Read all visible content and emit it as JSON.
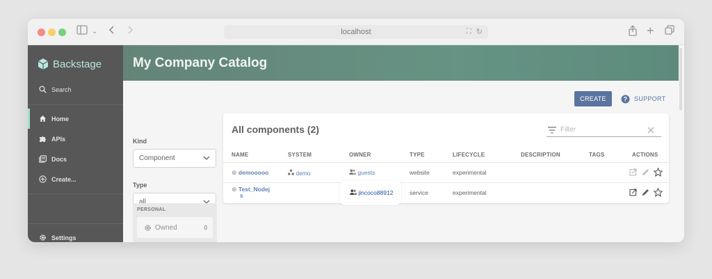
{
  "browser": {
    "url": "localhost",
    "traffic_lights": {
      "close": "#ef5f57",
      "minimize": "#f5bd2e",
      "maximize": "#3fbf4b"
    }
  },
  "sidebar": {
    "logo": "Backstage",
    "search": "Search",
    "items": [
      {
        "label": "Home",
        "icon": "home-icon"
      },
      {
        "label": "APIs",
        "icon": "puzzle-icon"
      },
      {
        "label": "Docs",
        "icon": "docs-icon"
      },
      {
        "label": "Create...",
        "icon": "add-circle-icon"
      }
    ],
    "settings": "Settings"
  },
  "header": {
    "title": "My Company Catalog"
  },
  "actions": {
    "create": "CREATE",
    "support": "SUPPORT"
  },
  "filters": {
    "kind_label": "Kind",
    "kind_value": "Component",
    "type_label": "Type",
    "type_value": "all",
    "personal_label": "PERSONAL",
    "owned_label": "Owned",
    "owned_count": "0"
  },
  "table": {
    "title": "All components (2)",
    "filter_placeholder": "Filter",
    "columns": [
      "NAME",
      "SYSTEM",
      "OWNER",
      "TYPE",
      "LIFECYCLE",
      "DESCRIPTION",
      "TAGS",
      "ACTIONS"
    ],
    "rows": [
      {
        "name": "demooooo",
        "system": "demo",
        "owner": "guests",
        "type": "website",
        "lifecycle": "experimental",
        "description": "",
        "tags": ""
      },
      {
        "name_line1": "Test_Nodej",
        "name_line2": "s",
        "system": "",
        "owner": "jincoco88912",
        "type": "service",
        "lifecycle": "experimental",
        "description": "",
        "tags": ""
      }
    ]
  },
  "colors": {
    "accent": "#1c3d7a",
    "header_gradient": "#2b6a55",
    "link": "#1f4fa0"
  }
}
